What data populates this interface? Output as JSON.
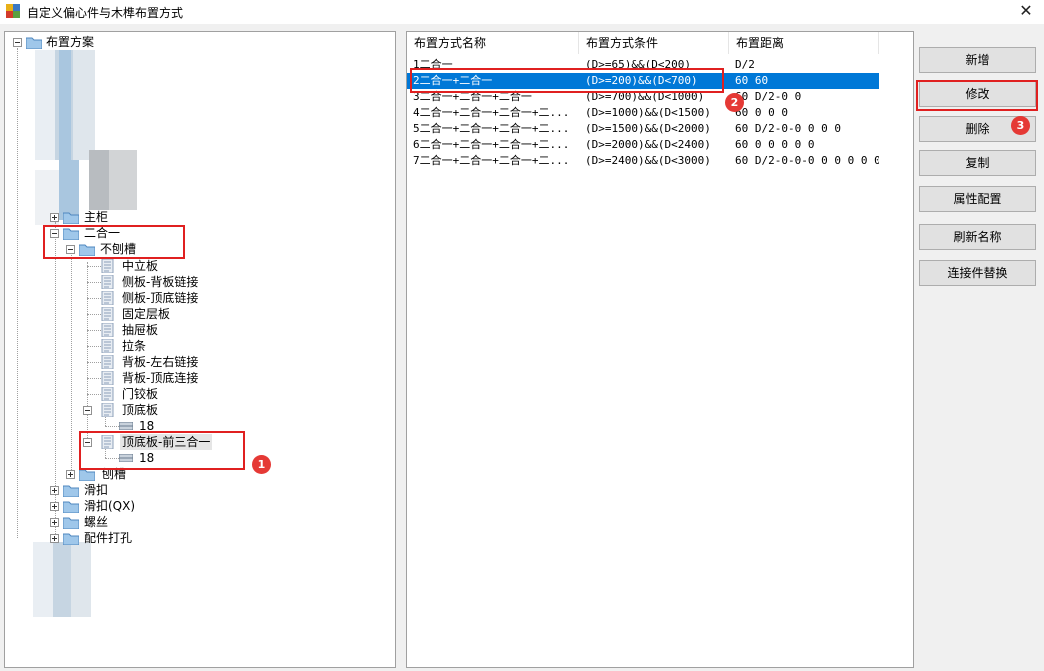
{
  "window": {
    "title": "自定义偏心件与木榫布置方式",
    "close_glyph": "✕"
  },
  "tree": {
    "root": "布置方案",
    "nodes": [
      {
        "label": "主柜"
      },
      {
        "label": "二合一"
      },
      {
        "label": "不刨槽"
      },
      {
        "label": "中立板"
      },
      {
        "label": "侧板-背板链接"
      },
      {
        "label": "侧板-顶底链接"
      },
      {
        "label": "固定层板"
      },
      {
        "label": "抽屉板"
      },
      {
        "label": "拉条"
      },
      {
        "label": "背板-左右链接"
      },
      {
        "label": "背板-顶底连接"
      },
      {
        "label": "门铰板"
      },
      {
        "label": "顶底板"
      },
      {
        "label": "18"
      },
      {
        "label": "顶底板-前三合一"
      },
      {
        "label": "18"
      },
      {
        "label": "刨槽"
      },
      {
        "label": "滑扣"
      },
      {
        "label": "滑扣(QX)"
      },
      {
        "label": "螺丝"
      },
      {
        "label": "配件打孔"
      }
    ]
  },
  "list": {
    "headers": [
      "布置方式名称",
      "布置方式条件",
      "布置距离"
    ],
    "rows": [
      [
        "1二合一",
        "(D>=65)&&(D<200)",
        "D/2"
      ],
      [
        "2二合一+二合一",
        "(D>=200)&&(D<700)",
        "60 60"
      ],
      [
        "3二合一+二合一+二合一",
        "(D>=700)&&(D<1000)",
        "60 D/2-0 0"
      ],
      [
        "4二合一+二合一+二合一+二...",
        "(D>=1000)&&(D<1500)",
        "60 0 0 0"
      ],
      [
        "5二合一+二合一+二合一+二...",
        "(D>=1500)&&(D<2000)",
        "60 D/2-0-0 0 0 0"
      ],
      [
        "6二合一+二合一+二合一+二...",
        "(D>=2000)&&(D<2400)",
        "60 0 0 0 0 0"
      ],
      [
        "7二合一+二合一+二合一+二...",
        "(D>=2400)&&(D<3000)",
        "60 D/2-0-0-0 0 0 0 0 0"
      ]
    ],
    "selected_row": 2
  },
  "buttons": {
    "add": "新增",
    "modify": "修改",
    "delete": "删除",
    "copy": "复制",
    "properties": "属性配置",
    "refresh_name": "刷新名称",
    "connector_replace": "连接件替换"
  },
  "badges": [
    "1",
    "2",
    "3"
  ],
  "colors": {
    "highlight_red": "#e02020",
    "badge_red": "#e53935",
    "selection_blue": "#0078d7"
  }
}
